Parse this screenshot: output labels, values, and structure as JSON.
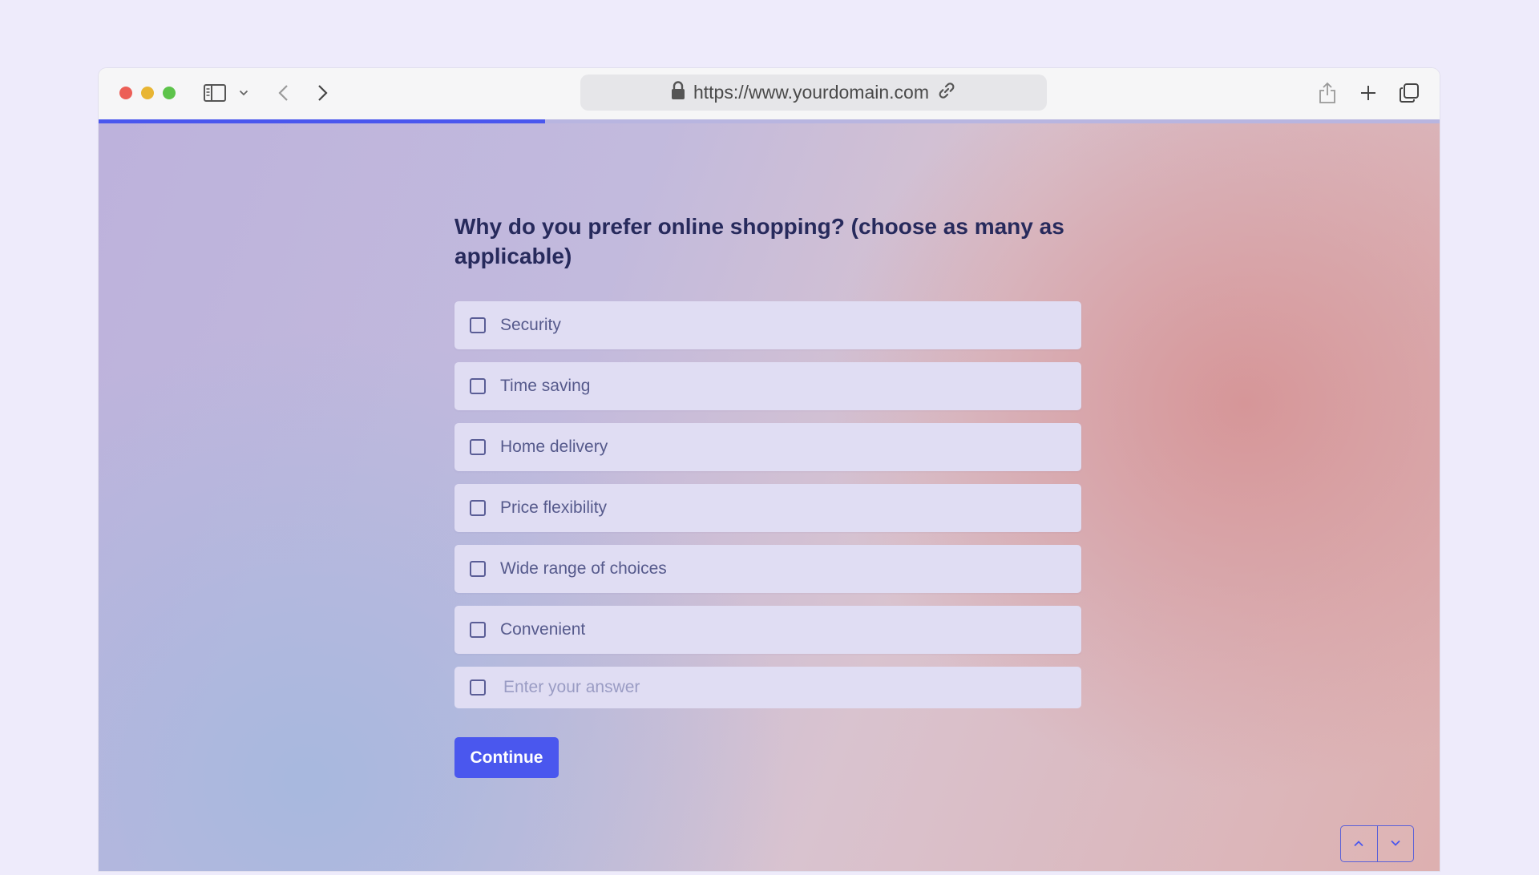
{
  "browser": {
    "url": "https://www.yourdomain.com",
    "icons": [
      "sidebar-icon",
      "chevron-down-icon",
      "back-icon",
      "forward-icon",
      "lock-icon",
      "link-icon",
      "share-icon",
      "plus-icon",
      "tabs-icon"
    ]
  },
  "progress": {
    "fraction": 0.333,
    "fill_color": "#4a57ee",
    "track_color": "#b8b5e0"
  },
  "form": {
    "question": "Why do you prefer online shopping? (choose as many as applicable)",
    "options": [
      {
        "label": "Security",
        "checked": false
      },
      {
        "label": "Time saving",
        "checked": false
      },
      {
        "label": "Home delivery",
        "checked": false
      },
      {
        "label": "Price flexibility",
        "checked": false
      },
      {
        "label": "Wide range of choices",
        "checked": false
      },
      {
        "label": "Convenient",
        "checked": false
      }
    ],
    "other": {
      "placeholder": "Enter your answer",
      "value": "",
      "checked": false
    },
    "continue_label": "Continue",
    "accent_color": "#4a57ee"
  },
  "navigation": {
    "up_icon": "chevron-up-icon",
    "down_icon": "chevron-down-icon"
  }
}
